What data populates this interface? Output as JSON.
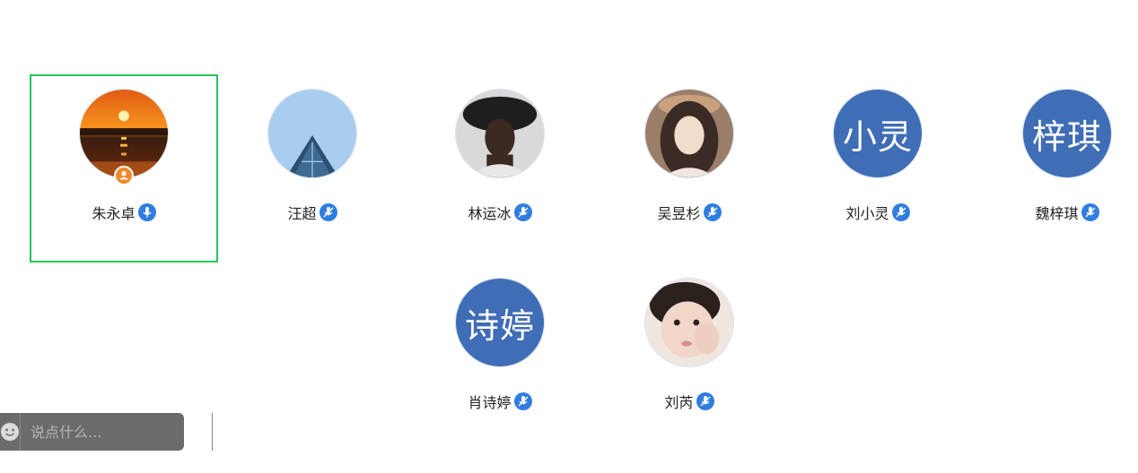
{
  "participants": [
    {
      "name": "朱永卓",
      "avatar": "sunset-photo",
      "host": true
    },
    {
      "name": "汪超",
      "avatar": "sky-architecture-photo"
    },
    {
      "name": "林运冰",
      "avatar": "man-portrait-photo"
    },
    {
      "name": "吴昱杉",
      "avatar": "woman-portrait-photo"
    },
    {
      "name": "刘小灵",
      "avatar_text": "小灵"
    },
    {
      "name": "魏梓琪",
      "avatar_text": "梓琪"
    },
    {
      "name": "肖诗婷",
      "avatar_text": "诗婷"
    },
    {
      "name": "刘芮",
      "avatar": "child-portrait-photo"
    }
  ],
  "chat": {
    "placeholder": "说点什么...",
    "emoji_icon": "emoji-icon",
    "collapse_icon": "chevron-left-icon"
  },
  "colors": {
    "active_border": "#22c55e",
    "text_avatar_bg": "#3f6db6",
    "mic_badge": "#2f7de1",
    "host_badge": "#f08a2c",
    "chat_bar_bg": "#6b6b6b"
  }
}
